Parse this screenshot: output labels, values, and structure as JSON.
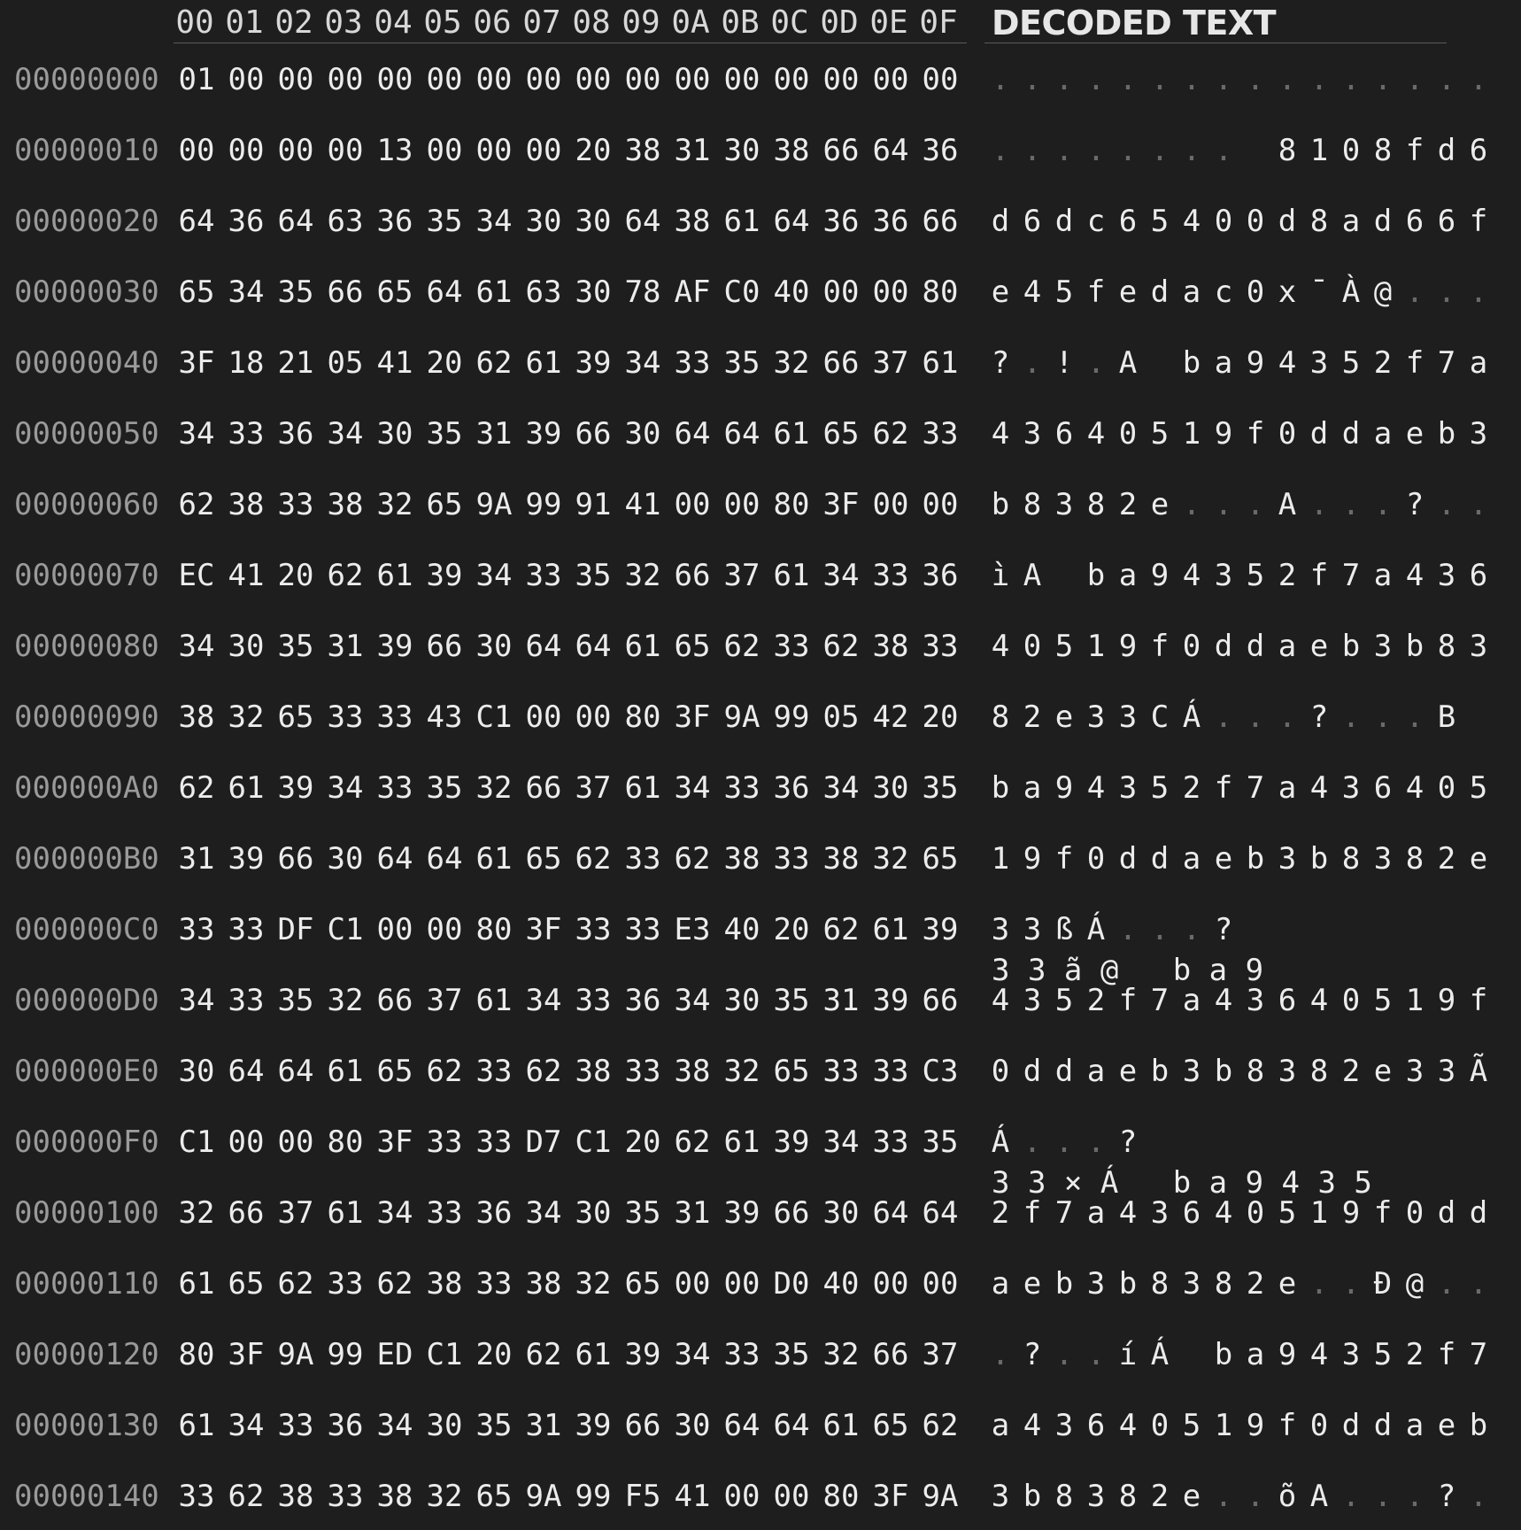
{
  "columns": [
    "00",
    "01",
    "02",
    "03",
    "04",
    "05",
    "06",
    "07",
    "08",
    "09",
    "0A",
    "0B",
    "0C",
    "0D",
    "0E",
    "0F"
  ],
  "decoded_header": "DECODED TEXT",
  "rows": [
    {
      "offset": "00000000",
      "bytes": [
        "01",
        "00",
        "00",
        "00",
        "00",
        "00",
        "00",
        "00",
        "00",
        "00",
        "00",
        "00",
        "00",
        "00",
        "00",
        "00"
      ],
      "text": [
        ".",
        ".",
        ".",
        ".",
        ".",
        ".",
        ".",
        ".",
        ".",
        ".",
        ".",
        ".",
        ".",
        ".",
        ".",
        "."
      ]
    },
    {
      "offset": "00000010",
      "bytes": [
        "00",
        "00",
        "00",
        "00",
        "13",
        "00",
        "00",
        "00",
        "20",
        "38",
        "31",
        "30",
        "38",
        "66",
        "64",
        "36"
      ],
      "text": [
        ".",
        ".",
        ".",
        ".",
        ".",
        ".",
        ".",
        ".",
        " ",
        "8",
        "1",
        "0",
        "8",
        "f",
        "d",
        "6"
      ]
    },
    {
      "offset": "00000020",
      "bytes": [
        "64",
        "36",
        "64",
        "63",
        "36",
        "35",
        "34",
        "30",
        "30",
        "64",
        "38",
        "61",
        "64",
        "36",
        "36",
        "66"
      ],
      "text": [
        "d",
        "6",
        "d",
        "c",
        "6",
        "5",
        "4",
        "0",
        "0",
        "d",
        "8",
        "a",
        "d",
        "6",
        "6",
        "f"
      ]
    },
    {
      "offset": "00000030",
      "bytes": [
        "65",
        "34",
        "35",
        "66",
        "65",
        "64",
        "61",
        "63",
        "30",
        "78",
        "AF",
        "C0",
        "40",
        "00",
        "00",
        "80"
      ],
      "text": [
        "e",
        "4",
        "5",
        "f",
        "e",
        "d",
        "a",
        "c",
        "0",
        "x",
        "¯",
        "À",
        "@",
        ".",
        ".",
        "."
      ]
    },
    {
      "offset": "00000040",
      "bytes": [
        "3F",
        "18",
        "21",
        "05",
        "41",
        "20",
        "62",
        "61",
        "39",
        "34",
        "33",
        "35",
        "32",
        "66",
        "37",
        "61"
      ],
      "text": [
        "?",
        ".",
        "!",
        ".",
        "A",
        " ",
        "b",
        "a",
        "9",
        "4",
        "3",
        "5",
        "2",
        "f",
        "7",
        "a"
      ]
    },
    {
      "offset": "00000050",
      "bytes": [
        "34",
        "33",
        "36",
        "34",
        "30",
        "35",
        "31",
        "39",
        "66",
        "30",
        "64",
        "64",
        "61",
        "65",
        "62",
        "33"
      ],
      "text": [
        "4",
        "3",
        "6",
        "4",
        "0",
        "5",
        "1",
        "9",
        "f",
        "0",
        "d",
        "d",
        "a",
        "e",
        "b",
        "3"
      ]
    },
    {
      "offset": "00000060",
      "bytes": [
        "62",
        "38",
        "33",
        "38",
        "32",
        "65",
        "9A",
        "99",
        "91",
        "41",
        "00",
        "00",
        "80",
        "3F",
        "00",
        "00"
      ],
      "text": [
        "b",
        "8",
        "3",
        "8",
        "2",
        "e",
        ".",
        ".",
        ".",
        "A",
        ".",
        ".",
        ".",
        "?",
        ".",
        "."
      ]
    },
    {
      "offset": "00000070",
      "bytes": [
        "EC",
        "41",
        "20",
        "62",
        "61",
        "39",
        "34",
        "33",
        "35",
        "32",
        "66",
        "37",
        "61",
        "34",
        "33",
        "36"
      ],
      "text": [
        "ì",
        "A",
        " ",
        "b",
        "a",
        "9",
        "4",
        "3",
        "5",
        "2",
        "f",
        "7",
        "a",
        "4",
        "3",
        "6"
      ]
    },
    {
      "offset": "00000080",
      "bytes": [
        "34",
        "30",
        "35",
        "31",
        "39",
        "66",
        "30",
        "64",
        "64",
        "61",
        "65",
        "62",
        "33",
        "62",
        "38",
        "33"
      ],
      "text": [
        "4",
        "0",
        "5",
        "1",
        "9",
        "f",
        "0",
        "d",
        "d",
        "a",
        "e",
        "b",
        "3",
        "b",
        "8",
        "3"
      ]
    },
    {
      "offset": "00000090",
      "bytes": [
        "38",
        "32",
        "65",
        "33",
        "33",
        "43",
        "C1",
        "00",
        "00",
        "80",
        "3F",
        "9A",
        "99",
        "05",
        "42",
        "20"
      ],
      "text": [
        "8",
        "2",
        "e",
        "3",
        "3",
        "C",
        "Á",
        ".",
        ".",
        ".",
        "?",
        ".",
        ".",
        ".",
        "B",
        " "
      ]
    },
    {
      "offset": "000000A0",
      "bytes": [
        "62",
        "61",
        "39",
        "34",
        "33",
        "35",
        "32",
        "66",
        "37",
        "61",
        "34",
        "33",
        "36",
        "34",
        "30",
        "35"
      ],
      "text": [
        "b",
        "a",
        "9",
        "4",
        "3",
        "5",
        "2",
        "f",
        "7",
        "a",
        "4",
        "3",
        "6",
        "4",
        "0",
        "5"
      ]
    },
    {
      "offset": "000000B0",
      "bytes": [
        "31",
        "39",
        "66",
        "30",
        "64",
        "64",
        "61",
        "65",
        "62",
        "33",
        "62",
        "38",
        "33",
        "38",
        "32",
        "65"
      ],
      "text": [
        "1",
        "9",
        "f",
        "0",
        "d",
        "d",
        "a",
        "e",
        "b",
        "3",
        "b",
        "8",
        "3",
        "8",
        "2",
        "e"
      ]
    },
    {
      "offset": "000000C0",
      "bytes": [
        "33",
        "33",
        "DF",
        "C1",
        "00",
        "00",
        "80",
        "3F",
        "33",
        "33",
        "E3",
        "40",
        "20",
        "62",
        "61",
        "39"
      ],
      "text": [
        "3",
        "3",
        "ß",
        "Á",
        ".",
        ".",
        ".",
        "?",
        "",
        "",
        "",
        "",
        "",
        "",
        "",
        ""
      ]
    },
    {
      "offset": "000000D0",
      "bytes": [
        "34",
        "33",
        "35",
        "32",
        "66",
        "37",
        "61",
        "34",
        "33",
        "36",
        "34",
        "30",
        "35",
        "31",
        "39",
        "66"
      ],
      "text": [
        "4",
        "3",
        "5",
        "2",
        "f",
        "7",
        "a",
        "4",
        "3",
        "6",
        "4",
        "0",
        "5",
        "1",
        "9",
        "f"
      ],
      "wrap": "3 3 ã @   b a 9"
    },
    {
      "offset": "000000E0",
      "bytes": [
        "30",
        "64",
        "64",
        "61",
        "65",
        "62",
        "33",
        "62",
        "38",
        "33",
        "38",
        "32",
        "65",
        "33",
        "33",
        "C3"
      ],
      "text": [
        "0",
        "d",
        "d",
        "a",
        "e",
        "b",
        "3",
        "b",
        "8",
        "3",
        "8",
        "2",
        "e",
        "3",
        "3",
        "Ã"
      ]
    },
    {
      "offset": "000000F0",
      "bytes": [
        "C1",
        "00",
        "00",
        "80",
        "3F",
        "33",
        "33",
        "D7",
        "C1",
        "20",
        "62",
        "61",
        "39",
        "34",
        "33",
        "35"
      ],
      "text": [
        "Á",
        ".",
        ".",
        ".",
        "?",
        "",
        "",
        "",
        "",
        "",
        "",
        "",
        "",
        "",
        "",
        ""
      ]
    },
    {
      "offset": "00000100",
      "bytes": [
        "32",
        "66",
        "37",
        "61",
        "34",
        "33",
        "36",
        "34",
        "30",
        "35",
        "31",
        "39",
        "66",
        "30",
        "64",
        "64"
      ],
      "text": [
        "2",
        "f",
        "7",
        "a",
        "4",
        "3",
        "6",
        "4",
        "0",
        "5",
        "1",
        "9",
        "f",
        "0",
        "d",
        "d"
      ],
      "wrap": "3 3 × Á   b a 9 4 3 5"
    },
    {
      "offset": "00000110",
      "bytes": [
        "61",
        "65",
        "62",
        "33",
        "62",
        "38",
        "33",
        "38",
        "32",
        "65",
        "00",
        "00",
        "D0",
        "40",
        "00",
        "00"
      ],
      "text": [
        "a",
        "e",
        "b",
        "3",
        "b",
        "8",
        "3",
        "8",
        "2",
        "e",
        ".",
        ".",
        "Ð",
        "@",
        ".",
        "."
      ]
    },
    {
      "offset": "00000120",
      "bytes": [
        "80",
        "3F",
        "9A",
        "99",
        "ED",
        "C1",
        "20",
        "62",
        "61",
        "39",
        "34",
        "33",
        "35",
        "32",
        "66",
        "37"
      ],
      "text": [
        ".",
        "?",
        ".",
        ".",
        "í",
        "Á",
        " ",
        "b",
        "a",
        "9",
        "4",
        "3",
        "5",
        "2",
        "f",
        "7"
      ]
    },
    {
      "offset": "00000130",
      "bytes": [
        "61",
        "34",
        "33",
        "36",
        "34",
        "30",
        "35",
        "31",
        "39",
        "66",
        "30",
        "64",
        "64",
        "61",
        "65",
        "62"
      ],
      "text": [
        "a",
        "4",
        "3",
        "6",
        "4",
        "0",
        "5",
        "1",
        "9",
        "f",
        "0",
        "d",
        "d",
        "a",
        "e",
        "b"
      ]
    },
    {
      "offset": "00000140",
      "bytes": [
        "33",
        "62",
        "38",
        "33",
        "38",
        "32",
        "65",
        "9A",
        "99",
        "F5",
        "41",
        "00",
        "00",
        "80",
        "3F",
        "9A"
      ],
      "text": [
        "3",
        "b",
        "8",
        "3",
        "8",
        "2",
        "e",
        ".",
        ".",
        "õ",
        "A",
        ".",
        ".",
        ".",
        "?",
        "."
      ]
    }
  ]
}
